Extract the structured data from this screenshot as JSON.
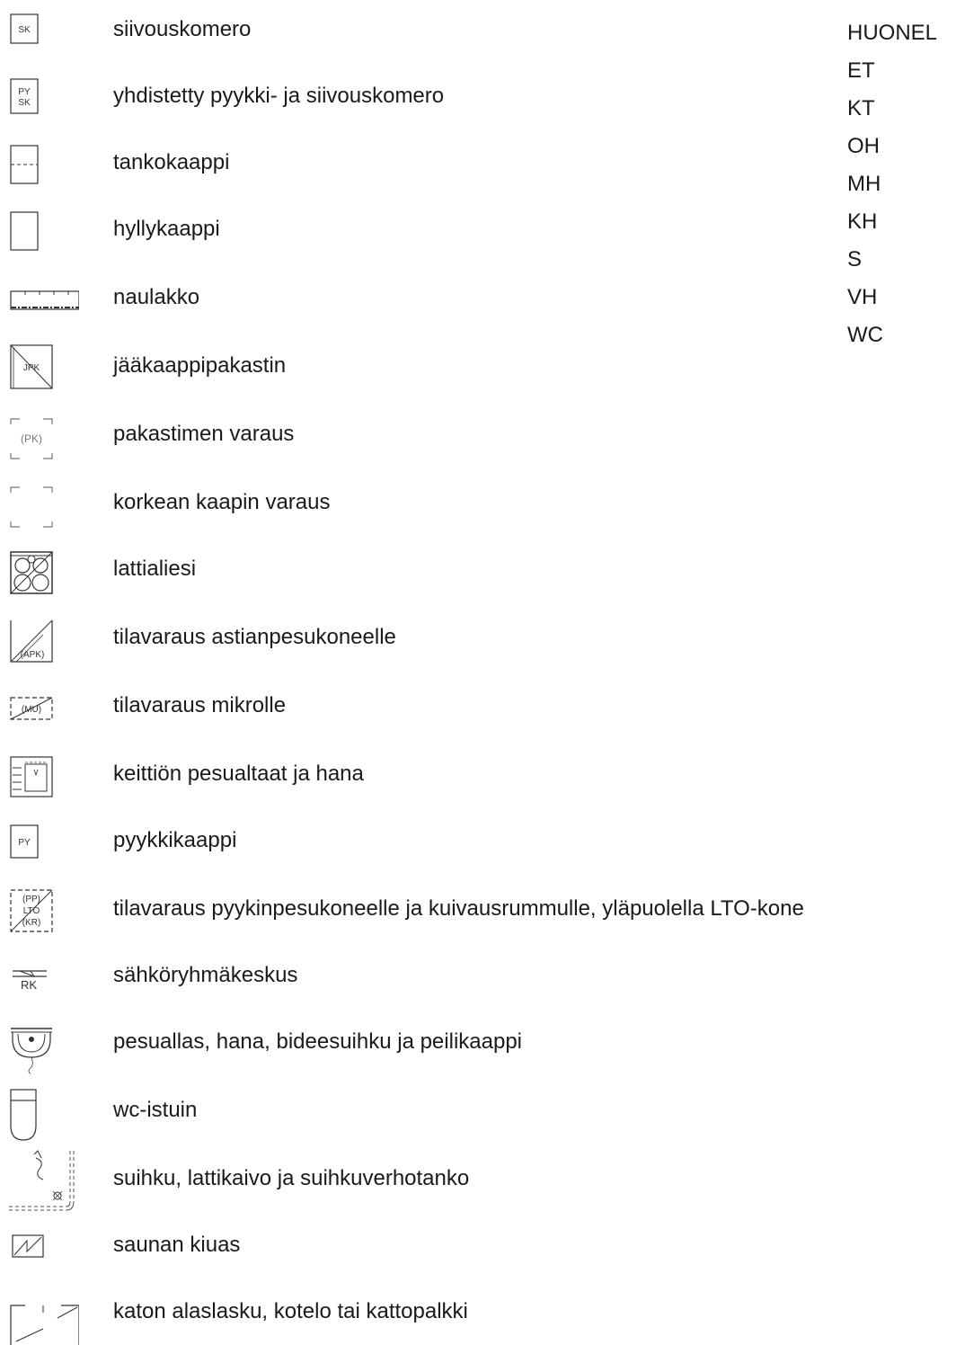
{
  "symbols": [
    {
      "icon": "siivouskomero-icon",
      "code": "SK",
      "label": "siivouskomero"
    },
    {
      "icon": "pyykki-siivouskomero-icon",
      "code_top": "PY",
      "code_bottom": "SK",
      "label": "yhdistetty pyykki- ja siivouskomero"
    },
    {
      "icon": "tankokaappi-icon",
      "label": "tankokaappi"
    },
    {
      "icon": "hyllykaappi-icon",
      "label": "hyllykaappi"
    },
    {
      "icon": "naulakko-icon",
      "label": "naulakko"
    },
    {
      "icon": "jaakaappipakastin-icon",
      "code": "JPK",
      "label": "jääkaappipakastin"
    },
    {
      "icon": "pakastimen-varaus-icon",
      "code": "(PK)",
      "label": "pakastimen varaus"
    },
    {
      "icon": "korkean-kaapin-varaus-icon",
      "label": "korkean kaapin varaus"
    },
    {
      "icon": "lattialiesi-icon",
      "label": "lattialiesi"
    },
    {
      "icon": "astianpesukone-varaus-icon",
      "code": "(APK)",
      "label": "tilavaraus astianpesukoneelle"
    },
    {
      "icon": "mikro-varaus-icon",
      "code": "(MU)",
      "label": "tilavaraus mikrolle"
    },
    {
      "icon": "keittion-pesuallas-icon",
      "label": "keittiön pesualtaat ja hana"
    },
    {
      "icon": "pyykkikaappi-icon",
      "code": "PY",
      "label": "pyykkikaappi"
    },
    {
      "icon": "pyykinpesukone-varaus-icon",
      "code_top": "(PP)",
      "code_mid": "LTO",
      "code_bottom": "(KR)",
      "label": "tilavaraus pyykinpesukoneelle ja kuivausrummulle, yläpuolella LTO-kone"
    },
    {
      "icon": "sahkoryhmakeskus-icon",
      "code": "RK",
      "label": "sähköryhmäkeskus"
    },
    {
      "icon": "pesuallas-hana-icon",
      "label": "pesuallas, hana, bideesuihku ja peilikaappi"
    },
    {
      "icon": "wc-istuin-icon",
      "label": "wc-istuin"
    },
    {
      "icon": "suihku-icon",
      "label": "suihku, lattikaivo ja suihkuverhotanko"
    },
    {
      "icon": "kiuas-icon",
      "label": "saunan kiuas"
    },
    {
      "icon": "katon-alaslasku-icon",
      "label": "katon alaslasku, kotelo tai kattopalkki"
    }
  ],
  "room_legend": {
    "title": "HUONEL",
    "items": [
      "ET",
      "KT",
      "OH",
      "MH",
      "KH",
      "S",
      "VH",
      "WC"
    ]
  }
}
